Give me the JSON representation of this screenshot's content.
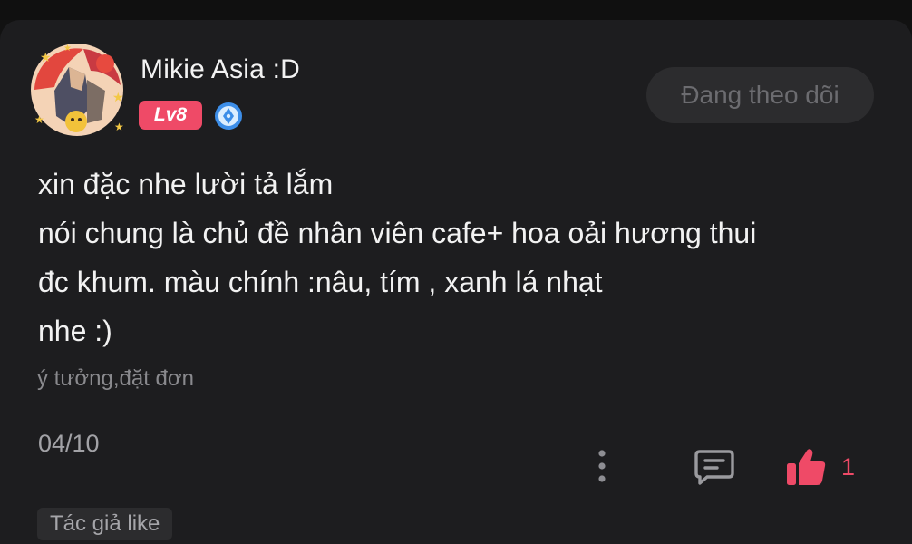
{
  "user": {
    "name": "Mikie Asia :D",
    "level": "Lv8"
  },
  "follow_button": {
    "label": "Đang theo dõi"
  },
  "post": {
    "lines": [
      "xin đặc nhe lười tả lắm",
      "nói chung là chủ đề nhân viên cafe+ hoa oải hương thui",
      "đc khum. màu chính :nâu, tím , xanh lá nhạt",
      "nhe :)"
    ],
    "tag": "ý tưởng,đặt đơn",
    "date": "04/10"
  },
  "actions": {
    "like_count": "1",
    "author_like_label": "Tác giả like"
  },
  "colors": {
    "background": "#1d1d1f",
    "accent": "#ef4a67",
    "button_bg": "#2c2c2e",
    "verify_blue": "#3d8ee8"
  },
  "icons": {
    "verify": "verified-pen-icon",
    "more": "more-vertical-icon",
    "comment": "comment-icon",
    "like": "thumbs-up-icon"
  }
}
